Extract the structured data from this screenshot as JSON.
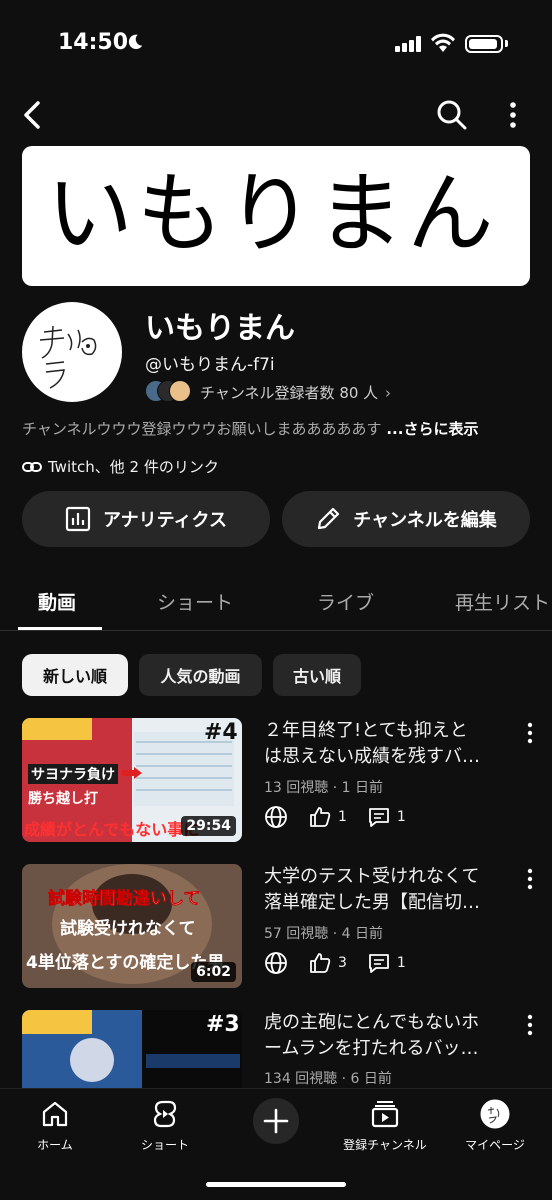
{
  "status": {
    "time": "14:50"
  },
  "channel": {
    "banner_text": "いもりまん",
    "name": "いもりまん",
    "handle": "@いもりまん-f7i",
    "subscribers": "チャンネル登録者数 80 人",
    "description": "チャンネルウウウ登録ウウウお願いしまあああああす",
    "more": "...さらに表示",
    "links": "Twitch、他 2 件のリンク",
    "avatar_scribble": "チラ"
  },
  "buttons": {
    "analytics": "アナリティクス",
    "edit_channel": "チャンネルを編集"
  },
  "tabs": [
    {
      "label": "動画",
      "active": true
    },
    {
      "label": "ショート"
    },
    {
      "label": "ライブ"
    },
    {
      "label": "再生リスト"
    }
  ],
  "chips": [
    {
      "label": "新しい順",
      "selected": true
    },
    {
      "label": "人気の動画"
    },
    {
      "label": "古い順"
    }
  ],
  "videos": [
    {
      "title_line1": "２年目終了!とても抑えと",
      "title_line2": "は思えない成績を残すバ…",
      "meta": "13 回視聴 · 1 日前",
      "likes": "1",
      "comments": "1",
      "duration": "29:54",
      "thumb_text_top": "#4",
      "thumb_text_a": "サヨナラ負け",
      "thumb_text_b": "勝ち越し打",
      "thumb_text_c": "成績がとんでもない事に"
    },
    {
      "title_line1": "大学のテスト受けれなくて",
      "title_line2": "落単確定した男【配信切…",
      "meta": "57 回視聴 · 4 日前",
      "likes": "3",
      "comments": "1",
      "duration": "6:02",
      "thumb_text_a": "試験時間勘違いして",
      "thumb_text_b": "試験受けれなくて",
      "thumb_text_c": "4単位落とすの確定した男"
    },
    {
      "title_line1": "虎の主砲にとんでもないホ",
      "title_line2": "ームランを打たれるバッ…",
      "meta": "134 回視聴 · 6 日前",
      "thumb_text_top": "#3"
    }
  ],
  "nav": [
    {
      "label": "ホーム",
      "icon": "home-icon"
    },
    {
      "label": "ショート",
      "icon": "shorts-icon"
    },
    {
      "label": "",
      "icon": "create-plus-icon"
    },
    {
      "label": "登録チャンネル",
      "icon": "subscriptions-icon"
    },
    {
      "label": "マイページ",
      "icon": "profile-avatar"
    }
  ],
  "colors": {
    "background": "#0f0f0f",
    "chip": "#272727",
    "text": "#f1f1f1",
    "secondary": "#aaaaaa"
  }
}
